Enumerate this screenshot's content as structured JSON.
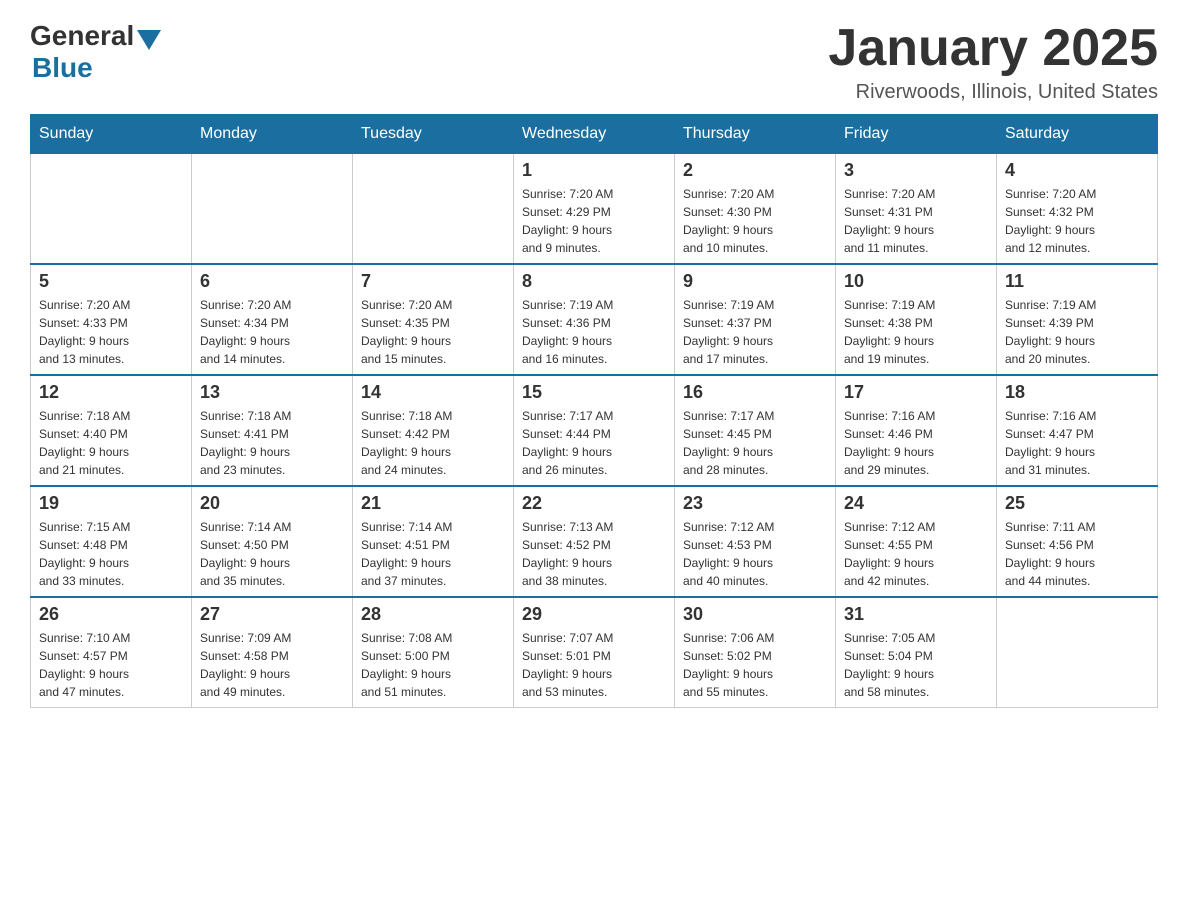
{
  "header": {
    "logo": {
      "general": "General",
      "blue": "Blue"
    },
    "title": "January 2025",
    "location": "Riverwoods, Illinois, United States"
  },
  "calendar": {
    "days_of_week": [
      "Sunday",
      "Monday",
      "Tuesday",
      "Wednesday",
      "Thursday",
      "Friday",
      "Saturday"
    ],
    "weeks": [
      [
        {
          "day": "",
          "info": ""
        },
        {
          "day": "",
          "info": ""
        },
        {
          "day": "",
          "info": ""
        },
        {
          "day": "1",
          "info": "Sunrise: 7:20 AM\nSunset: 4:29 PM\nDaylight: 9 hours\nand 9 minutes."
        },
        {
          "day": "2",
          "info": "Sunrise: 7:20 AM\nSunset: 4:30 PM\nDaylight: 9 hours\nand 10 minutes."
        },
        {
          "day": "3",
          "info": "Sunrise: 7:20 AM\nSunset: 4:31 PM\nDaylight: 9 hours\nand 11 minutes."
        },
        {
          "day": "4",
          "info": "Sunrise: 7:20 AM\nSunset: 4:32 PM\nDaylight: 9 hours\nand 12 minutes."
        }
      ],
      [
        {
          "day": "5",
          "info": "Sunrise: 7:20 AM\nSunset: 4:33 PM\nDaylight: 9 hours\nand 13 minutes."
        },
        {
          "day": "6",
          "info": "Sunrise: 7:20 AM\nSunset: 4:34 PM\nDaylight: 9 hours\nand 14 minutes."
        },
        {
          "day": "7",
          "info": "Sunrise: 7:20 AM\nSunset: 4:35 PM\nDaylight: 9 hours\nand 15 minutes."
        },
        {
          "day": "8",
          "info": "Sunrise: 7:19 AM\nSunset: 4:36 PM\nDaylight: 9 hours\nand 16 minutes."
        },
        {
          "day": "9",
          "info": "Sunrise: 7:19 AM\nSunset: 4:37 PM\nDaylight: 9 hours\nand 17 minutes."
        },
        {
          "day": "10",
          "info": "Sunrise: 7:19 AM\nSunset: 4:38 PM\nDaylight: 9 hours\nand 19 minutes."
        },
        {
          "day": "11",
          "info": "Sunrise: 7:19 AM\nSunset: 4:39 PM\nDaylight: 9 hours\nand 20 minutes."
        }
      ],
      [
        {
          "day": "12",
          "info": "Sunrise: 7:18 AM\nSunset: 4:40 PM\nDaylight: 9 hours\nand 21 minutes."
        },
        {
          "day": "13",
          "info": "Sunrise: 7:18 AM\nSunset: 4:41 PM\nDaylight: 9 hours\nand 23 minutes."
        },
        {
          "day": "14",
          "info": "Sunrise: 7:18 AM\nSunset: 4:42 PM\nDaylight: 9 hours\nand 24 minutes."
        },
        {
          "day": "15",
          "info": "Sunrise: 7:17 AM\nSunset: 4:44 PM\nDaylight: 9 hours\nand 26 minutes."
        },
        {
          "day": "16",
          "info": "Sunrise: 7:17 AM\nSunset: 4:45 PM\nDaylight: 9 hours\nand 28 minutes."
        },
        {
          "day": "17",
          "info": "Sunrise: 7:16 AM\nSunset: 4:46 PM\nDaylight: 9 hours\nand 29 minutes."
        },
        {
          "day": "18",
          "info": "Sunrise: 7:16 AM\nSunset: 4:47 PM\nDaylight: 9 hours\nand 31 minutes."
        }
      ],
      [
        {
          "day": "19",
          "info": "Sunrise: 7:15 AM\nSunset: 4:48 PM\nDaylight: 9 hours\nand 33 minutes."
        },
        {
          "day": "20",
          "info": "Sunrise: 7:14 AM\nSunset: 4:50 PM\nDaylight: 9 hours\nand 35 minutes."
        },
        {
          "day": "21",
          "info": "Sunrise: 7:14 AM\nSunset: 4:51 PM\nDaylight: 9 hours\nand 37 minutes."
        },
        {
          "day": "22",
          "info": "Sunrise: 7:13 AM\nSunset: 4:52 PM\nDaylight: 9 hours\nand 38 minutes."
        },
        {
          "day": "23",
          "info": "Sunrise: 7:12 AM\nSunset: 4:53 PM\nDaylight: 9 hours\nand 40 minutes."
        },
        {
          "day": "24",
          "info": "Sunrise: 7:12 AM\nSunset: 4:55 PM\nDaylight: 9 hours\nand 42 minutes."
        },
        {
          "day": "25",
          "info": "Sunrise: 7:11 AM\nSunset: 4:56 PM\nDaylight: 9 hours\nand 44 minutes."
        }
      ],
      [
        {
          "day": "26",
          "info": "Sunrise: 7:10 AM\nSunset: 4:57 PM\nDaylight: 9 hours\nand 47 minutes."
        },
        {
          "day": "27",
          "info": "Sunrise: 7:09 AM\nSunset: 4:58 PM\nDaylight: 9 hours\nand 49 minutes."
        },
        {
          "day": "28",
          "info": "Sunrise: 7:08 AM\nSunset: 5:00 PM\nDaylight: 9 hours\nand 51 minutes."
        },
        {
          "day": "29",
          "info": "Sunrise: 7:07 AM\nSunset: 5:01 PM\nDaylight: 9 hours\nand 53 minutes."
        },
        {
          "day": "30",
          "info": "Sunrise: 7:06 AM\nSunset: 5:02 PM\nDaylight: 9 hours\nand 55 minutes."
        },
        {
          "day": "31",
          "info": "Sunrise: 7:05 AM\nSunset: 5:04 PM\nDaylight: 9 hours\nand 58 minutes."
        },
        {
          "day": "",
          "info": ""
        }
      ]
    ]
  }
}
